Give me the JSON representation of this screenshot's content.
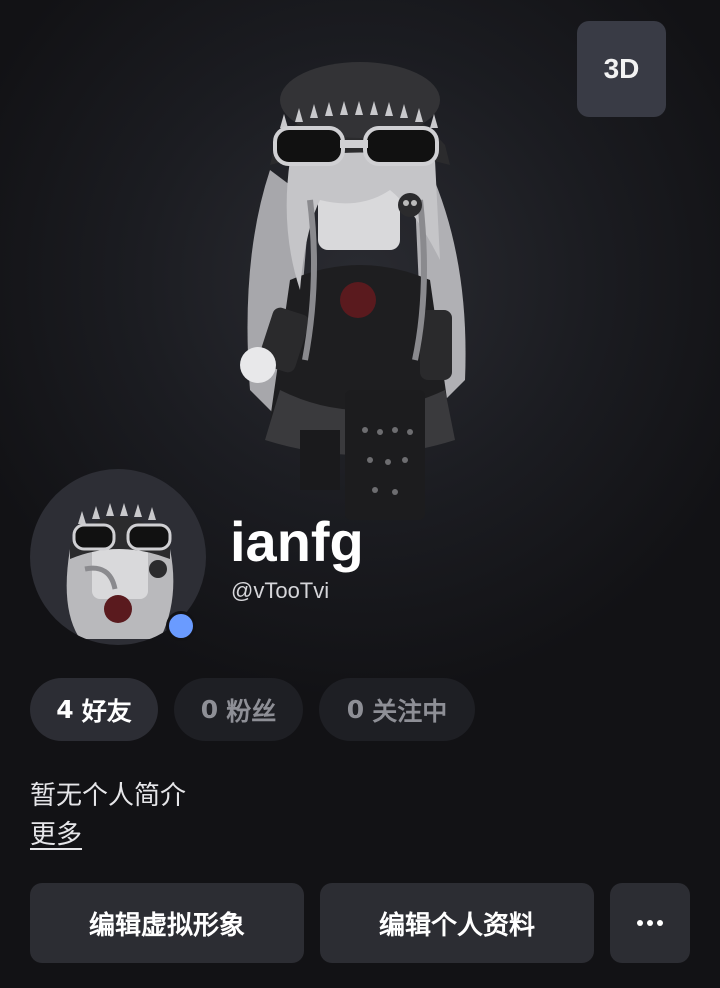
{
  "header": {
    "view_3d_label": "3D"
  },
  "profile": {
    "display_name": "ianfg",
    "username": "@vTooTvi",
    "online_status_color": "#6a9bff"
  },
  "stats": [
    {
      "count": "4",
      "label": "好友"
    },
    {
      "count": "0",
      "label": "粉丝"
    },
    {
      "count": "0",
      "label": "关注中"
    }
  ],
  "about": {
    "bio": "暂无个人简介",
    "more_label": "更多"
  },
  "actions": {
    "edit_avatar_label": "编辑虚拟形象",
    "edit_profile_label": "编辑个人资料",
    "more_icon": "ellipsis-icon"
  },
  "colors": {
    "background": "#121215",
    "chip_active": "#2c2d34",
    "chip_muted": "#1e1f24",
    "button": "#2c2d33"
  }
}
